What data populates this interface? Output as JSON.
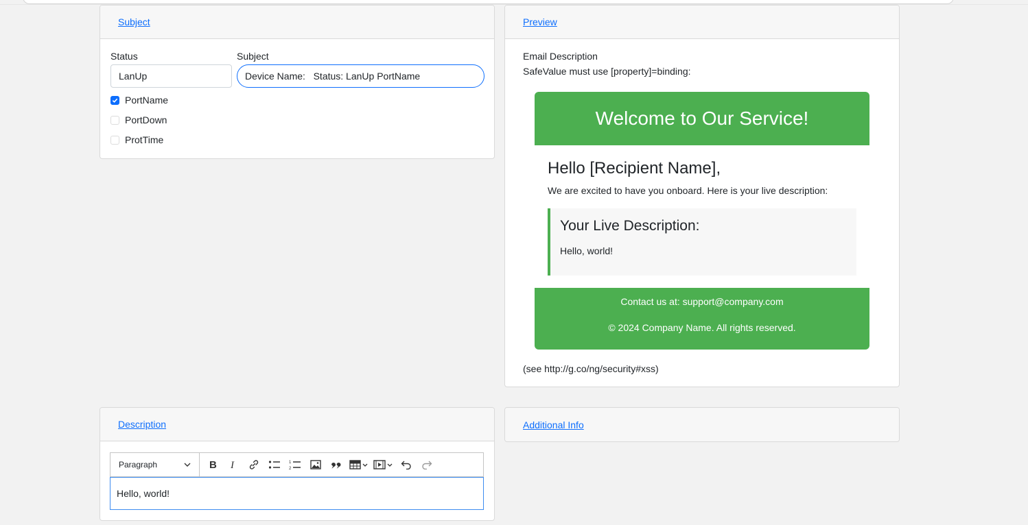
{
  "subject_card": {
    "header_link": "Subject",
    "status_label": "Status",
    "status_value": "LanUp",
    "subject_label": "Subject",
    "subject_value": "Device Name:   Status: LanUp PortName",
    "checkboxes": [
      {
        "label": "PortName",
        "checked": true
      },
      {
        "label": "PortDown",
        "checked": false
      },
      {
        "label": "ProtTime",
        "checked": false
      }
    ]
  },
  "preview_card": {
    "header_link": "Preview",
    "email_description": "Email Description",
    "safevalue_note": "SafeValue must use [property]=binding:",
    "email": {
      "header_title": "Welcome to Our Service!",
      "greeting": "Hello [Recipient Name],",
      "intro": "We are excited to have you onboard. Here is your live description:",
      "live_title": "Your Live Description:",
      "live_text": "Hello, world!",
      "footer_contact": "Contact us at: support@company.com",
      "footer_copyright": "© 2024 Company Name. All rights reserved."
    },
    "security_note": "(see http://g.co/ng/security#xss)",
    "accent_color": "#4caf50"
  },
  "description_card": {
    "header_link": "Description",
    "toolbar": {
      "paragraph_select": "Paragraph",
      "icons": [
        "bold-icon",
        "italic-icon",
        "link-icon",
        "bulleted-list-icon",
        "numbered-list-icon",
        "image-icon",
        "blockquote-icon",
        "table-icon",
        "media-icon",
        "undo-icon",
        "redo-icon"
      ]
    },
    "editor_content": "Hello, world!"
  },
  "additional_card": {
    "header_link": "Additional Info"
  },
  "colors": {
    "link": "#0d6efd",
    "checkbox_checked": "#0d6efd",
    "background": "#f2f2f2"
  }
}
